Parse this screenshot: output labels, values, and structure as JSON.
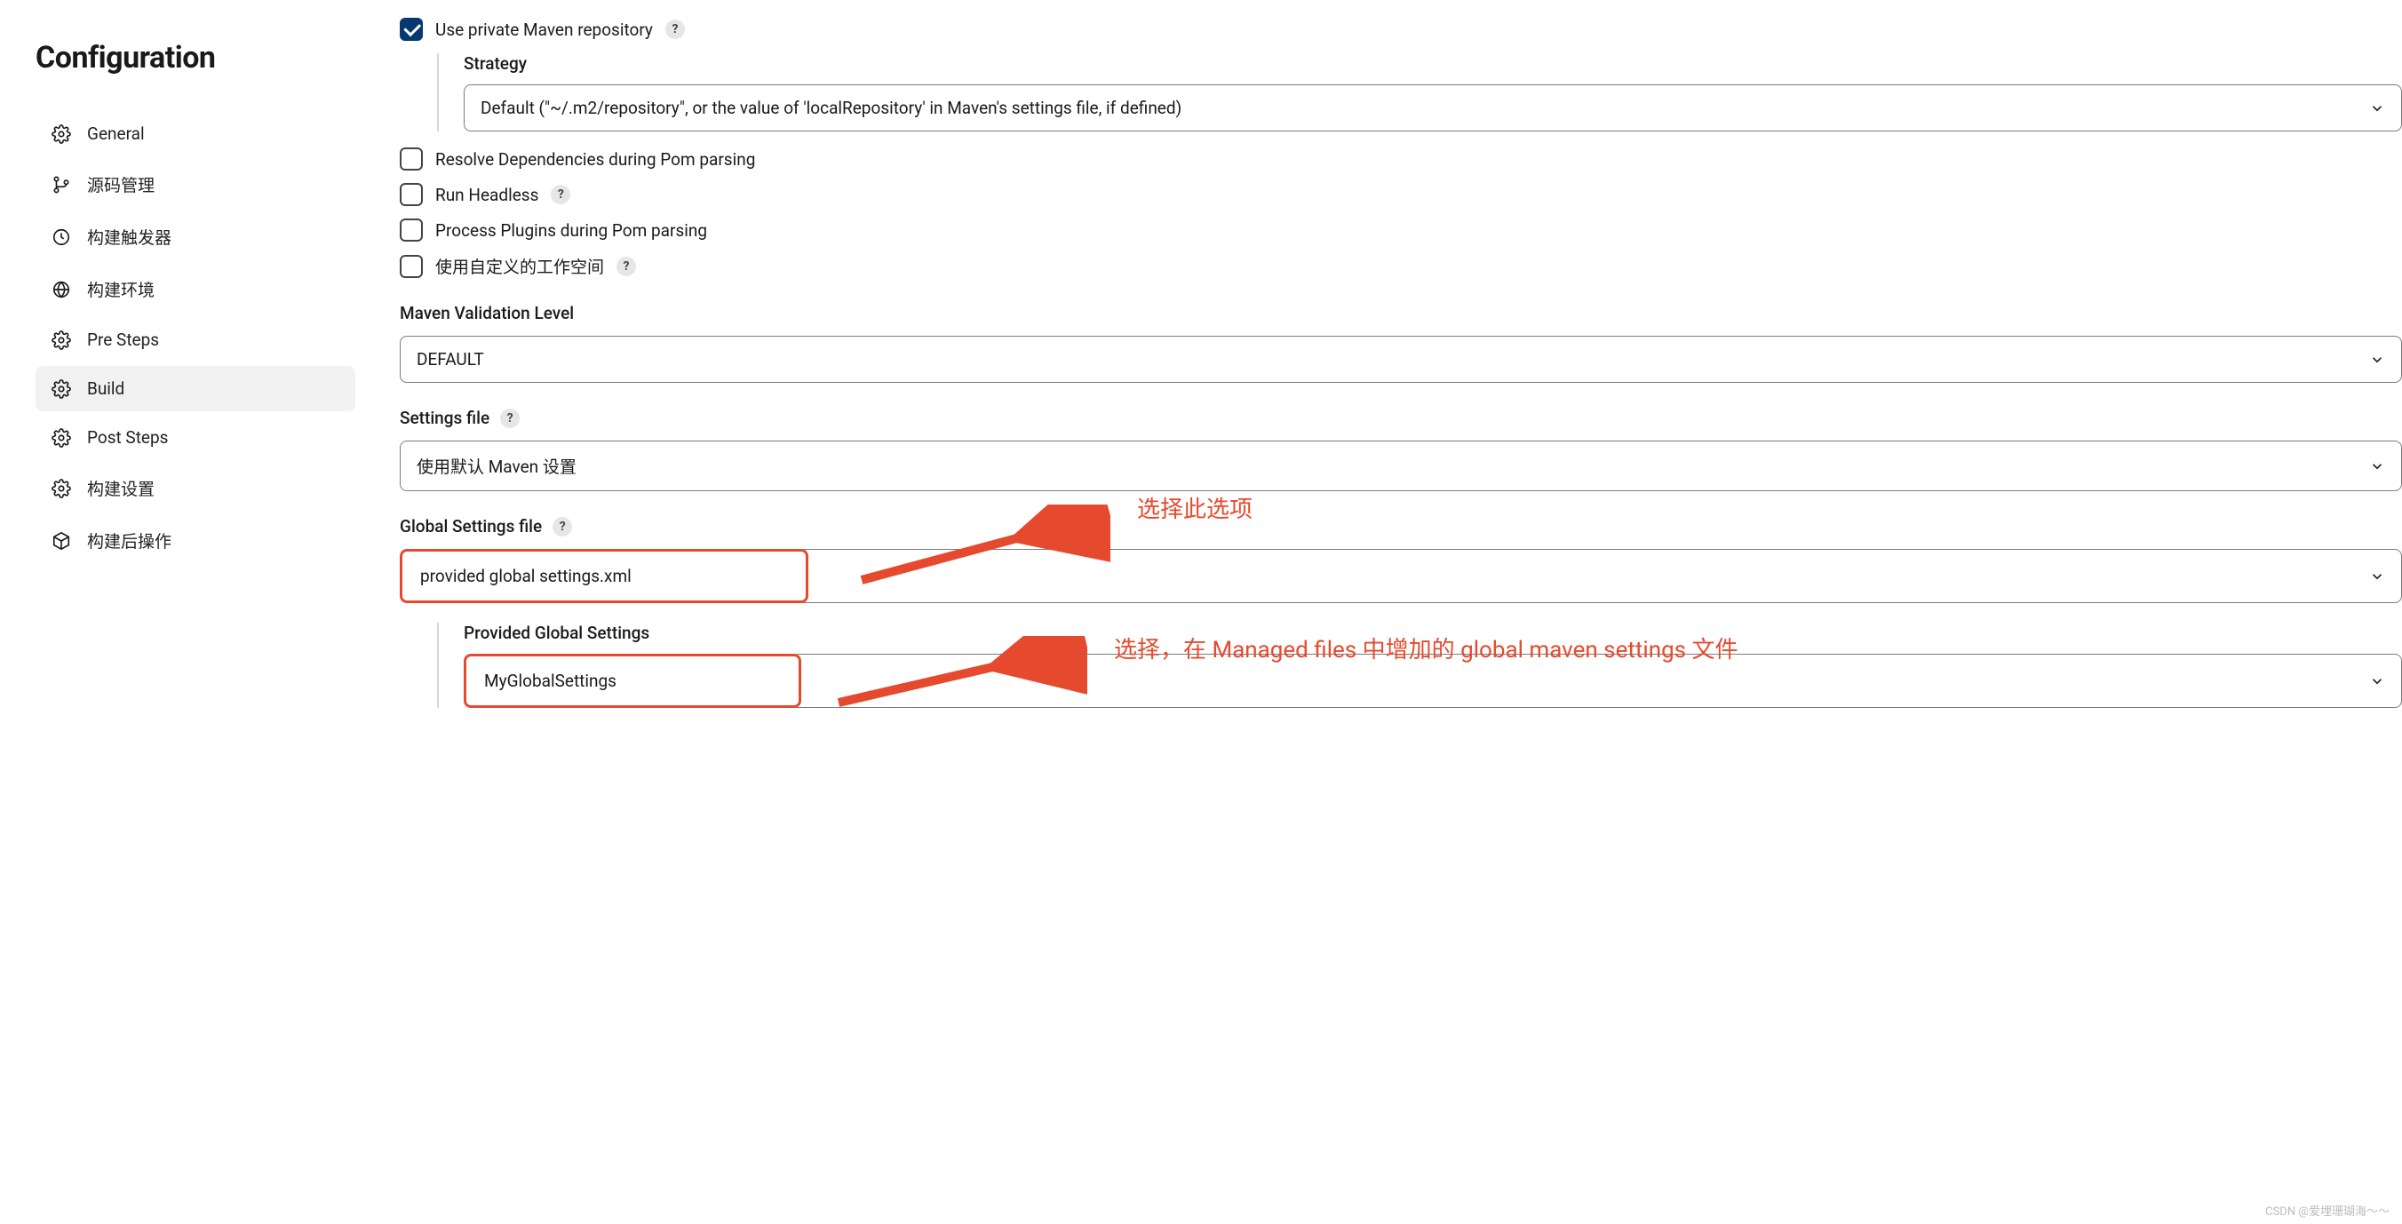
{
  "sidebar": {
    "title": "Configuration",
    "items": [
      {
        "label": "General"
      },
      {
        "label": "源码管理"
      },
      {
        "label": "构建触发器"
      },
      {
        "label": "构建环境"
      },
      {
        "label": "Pre Steps"
      },
      {
        "label": "Build"
      },
      {
        "label": "Post Steps"
      },
      {
        "label": "构建设置"
      },
      {
        "label": "构建后操作"
      }
    ],
    "active_index": 5
  },
  "form": {
    "use_private_repo": {
      "label": "Use private Maven repository",
      "checked": true
    },
    "strategy": {
      "label": "Strategy",
      "value": "Default (\"~/.m2/repository\", or the value of 'localRepository' in Maven's settings file, if defined)"
    },
    "resolve_deps": {
      "label": "Resolve Dependencies during Pom parsing",
      "checked": false
    },
    "run_headless": {
      "label": "Run Headless",
      "checked": false
    },
    "process_plugins": {
      "label": "Process Plugins during Pom parsing",
      "checked": false
    },
    "custom_workspace": {
      "label": "使用自定义的工作空间",
      "checked": false
    },
    "validation_level": {
      "label": "Maven Validation Level",
      "value": "DEFAULT"
    },
    "settings_file": {
      "label": "Settings file",
      "value": "使用默认 Maven 设置"
    },
    "global_settings": {
      "label": "Global Settings file",
      "value": "provided global settings.xml"
    },
    "provided_global": {
      "label": "Provided Global Settings",
      "value": "MyGlobalSettings"
    }
  },
  "annotations": {
    "a1": "选择此选项",
    "a2": "选择，在 Managed files 中增加的 global maven settings 文件"
  },
  "watermark": "CSDN @爱埋珊瑚海～～"
}
